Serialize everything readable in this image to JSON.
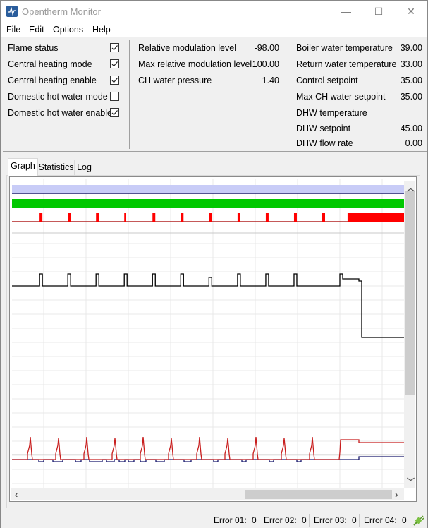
{
  "window": {
    "title": "Opentherm Monitor",
    "controls": {
      "minimize": "—",
      "maximize": "☐",
      "close": "✕"
    }
  },
  "menu": [
    "File",
    "Edit",
    "Options",
    "Help"
  ],
  "status_flags": [
    {
      "label": "Flame status",
      "checked": true
    },
    {
      "label": "Central heating mode",
      "checked": true
    },
    {
      "label": "Central heating enable",
      "checked": true
    },
    {
      "label": "Domestic hot water mode",
      "checked": false
    },
    {
      "label": "Domestic hot water enable",
      "checked": true
    }
  ],
  "modulation": [
    {
      "label": "Relative modulation level",
      "value": "-98.00"
    },
    {
      "label": "Max relative modulation level",
      "value": "100.00"
    },
    {
      "label": "CH water pressure",
      "value": "1.40"
    }
  ],
  "temperatures": [
    {
      "label": "Boiler water temperature",
      "value": "39.00"
    },
    {
      "label": "Return water temperature",
      "value": "33.00"
    },
    {
      "label": "Control setpoint",
      "value": "35.00"
    },
    {
      "label": "Max CH water setpoint",
      "value": "35.00"
    },
    {
      "label": "DHW temperature",
      "value": ""
    },
    {
      "label": "DHW setpoint",
      "value": "45.00"
    },
    {
      "label": "DHW flow rate",
      "value": "0.00"
    }
  ],
  "tabs": [
    {
      "label": "Graph",
      "active": true
    },
    {
      "label": "Statistics",
      "active": false
    },
    {
      "label": "Log",
      "active": false
    }
  ],
  "graph": {
    "colors": {
      "dhw_band": "#c8ccf7",
      "dhw_line": "#1a1a6e",
      "ch_band": "#00c800",
      "flame": "#ff0000",
      "flame_line": "#b22222",
      "modulation": "#000000",
      "boiler_temp": "#c81e1e",
      "return_temp": "#1a1a6e",
      "grid": "#e8e8e8"
    },
    "flame_pulses_t": [
      0.038,
      0.11,
      0.182,
      0.254,
      0.326,
      0.398,
      0.47,
      0.543,
      0.615,
      0.687,
      0.759
    ],
    "flame_on_from_t": 0.838,
    "modulation_pulses_t": [
      0.038,
      0.11,
      0.182,
      0.254,
      0.326,
      0.398,
      0.47,
      0.543,
      0.615,
      0.687,
      0.763
    ],
    "modulation_pulse_short": [
      false,
      false,
      false,
      false,
      false,
      false,
      true,
      false,
      false,
      false,
      true
    ]
  },
  "status_bar": [
    {
      "label": "Error 01:",
      "value": "0"
    },
    {
      "label": "Error 02:",
      "value": "0"
    },
    {
      "label": "Error 03:",
      "value": "0"
    },
    {
      "label": "Error 04:",
      "value": "0"
    }
  ],
  "connection_icon": "plug-connected-icon"
}
